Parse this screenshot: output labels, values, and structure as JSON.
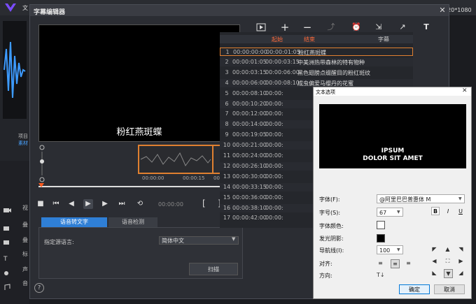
{
  "app": {
    "title": "文",
    "resolution": "920*1080"
  },
  "background_left": {
    "project_label": "项目",
    "material_label": "素材",
    "track_labels": [
      "视",
      "叠",
      "叠",
      "标",
      "声",
      "音"
    ]
  },
  "dialog": {
    "title": "字幕编辑器",
    "preview_subtitle": "粉红燕斑蝶",
    "clip_times": [
      "00:00:00",
      "00:00:15",
      "00:00:"
    ],
    "timecode": "00:00:00",
    "tabs": [
      "语音转文字",
      "语音检测"
    ],
    "language_label": "指定源语言:",
    "language_value": "简体中文",
    "scan_label": "扫描",
    "help_label": "?",
    "toolbar_icons": [
      "play-subtitle-icon",
      "add-icon",
      "remove-icon",
      "merge-icon",
      "timing-icon",
      "import-icon",
      "export-icon",
      "text-options-icon"
    ],
    "list_headers": {
      "start": "起始",
      "end": "结束",
      "subtitle": "字幕"
    },
    "rows": [
      {
        "n": "1",
        "s": "00:00:00:00",
        "e": "00:00:01:05",
        "t": "粉红燕斑蝶"
      },
      {
        "n": "2",
        "s": "00:00:01:05",
        "e": "00:00:03:15",
        "t": "中美洲热带森林的特有物种"
      },
      {
        "n": "3",
        "s": "00:00:03:15",
        "e": "00:00:06:00",
        "t": "黑色翅膀点缀醒目的粉红斑纹"
      },
      {
        "n": "4",
        "s": "00:00:06:00",
        "e": "00:00:08:10",
        "t": "成虫偏爱马缨丹的花蜜"
      },
      {
        "n": "5",
        "s": "00:00:08:10",
        "e": "00:00:",
        "t": ""
      },
      {
        "n": "6",
        "s": "00:00:10:20",
        "e": "00:00:",
        "t": ""
      },
      {
        "n": "7",
        "s": "00:00:12:00",
        "e": "00:00:",
        "t": ""
      },
      {
        "n": "8",
        "s": "00:00:14:00",
        "e": "00:00:",
        "t": ""
      },
      {
        "n": "9",
        "s": "00:00:19:05",
        "e": "00:00:",
        "t": ""
      },
      {
        "n": "10",
        "s": "00:00:21:00",
        "e": "00:00:",
        "t": ""
      },
      {
        "n": "11",
        "s": "00:00:24:00",
        "e": "00:00:",
        "t": ""
      },
      {
        "n": "12",
        "s": "00:00:26:10",
        "e": "00:00:",
        "t": ""
      },
      {
        "n": "13",
        "s": "00:00:30:00",
        "e": "00:00:",
        "t": ""
      },
      {
        "n": "14",
        "s": "00:00:33:15",
        "e": "00:00:",
        "t": ""
      },
      {
        "n": "15",
        "s": "00:00:36:00",
        "e": "00:00:",
        "t": ""
      },
      {
        "n": "16",
        "s": "00:00:38:10",
        "e": "00:00:",
        "t": ""
      },
      {
        "n": "17",
        "s": "00:00:42:00",
        "e": "00:00:",
        "t": ""
      }
    ]
  },
  "text_options": {
    "title": "文本选项",
    "preview_line1": "IPSUM",
    "preview_line2": "DOLOR SIT AMET",
    "font_label": "字体(F):",
    "font_value": "@阿里巴巴普惠体 M",
    "size_label": "字号(S):",
    "size_value": "67",
    "color_label": "字体颜色:",
    "shadow_label": "发光阴影:",
    "line_height_label": "导航线(I):",
    "line_height_value": "100",
    "align_label": "对齐:",
    "direction_label": "方向:",
    "bold": "B",
    "italic": "I",
    "underline": "U",
    "ok": "确定",
    "cancel": "取消"
  },
  "colors": {
    "accent": "#e08030",
    "tab_active": "#2f7fd6",
    "header_text": "#ff6a3a"
  }
}
